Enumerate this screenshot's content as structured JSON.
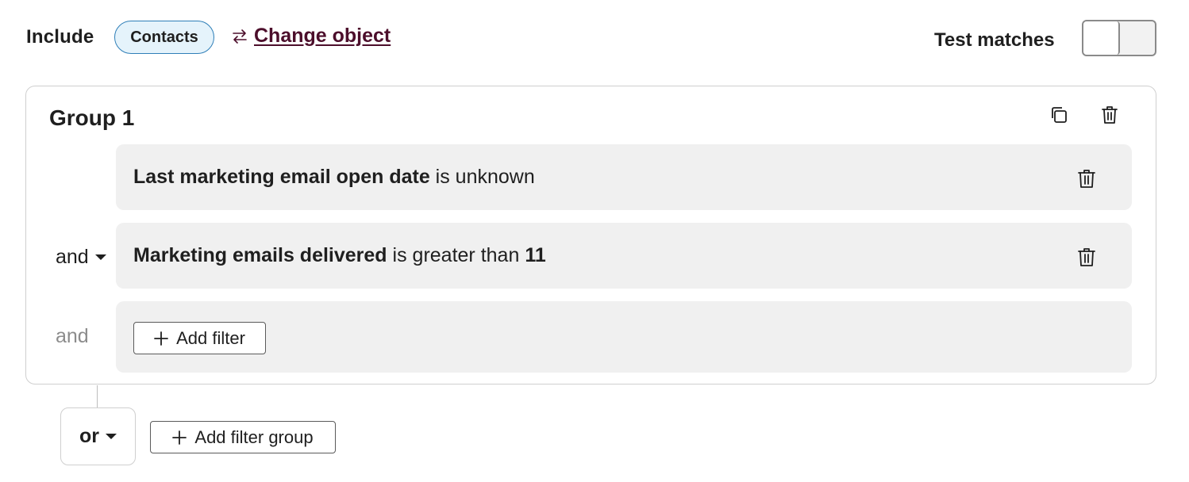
{
  "header": {
    "include_label": "Include",
    "object_pill": "Contacts",
    "change_object_link": "Change object",
    "test_matches_label": "Test matches",
    "toggle_on": false
  },
  "group": {
    "title": "Group 1",
    "filters": [
      {
        "property": "Last marketing email open date",
        "operator": " is unknown",
        "value": ""
      },
      {
        "property": "Marketing emails delivered",
        "operator": " is greater than ",
        "value": "11"
      }
    ],
    "connectors": [
      "and",
      "and"
    ],
    "add_filter_label": "Add filter"
  },
  "footer": {
    "or_label": "or",
    "add_filter_group_label": "Add filter group"
  },
  "colors": {
    "pill_border": "#2f7fb8",
    "pill_bg": "#e5f3fb",
    "link": "#4c0e2b",
    "row_bg": "#f0f0f0"
  },
  "icons": [
    "swap-arrows-icon",
    "copy-icon",
    "trash-icon",
    "plus-icon",
    "caret-down-icon"
  ]
}
